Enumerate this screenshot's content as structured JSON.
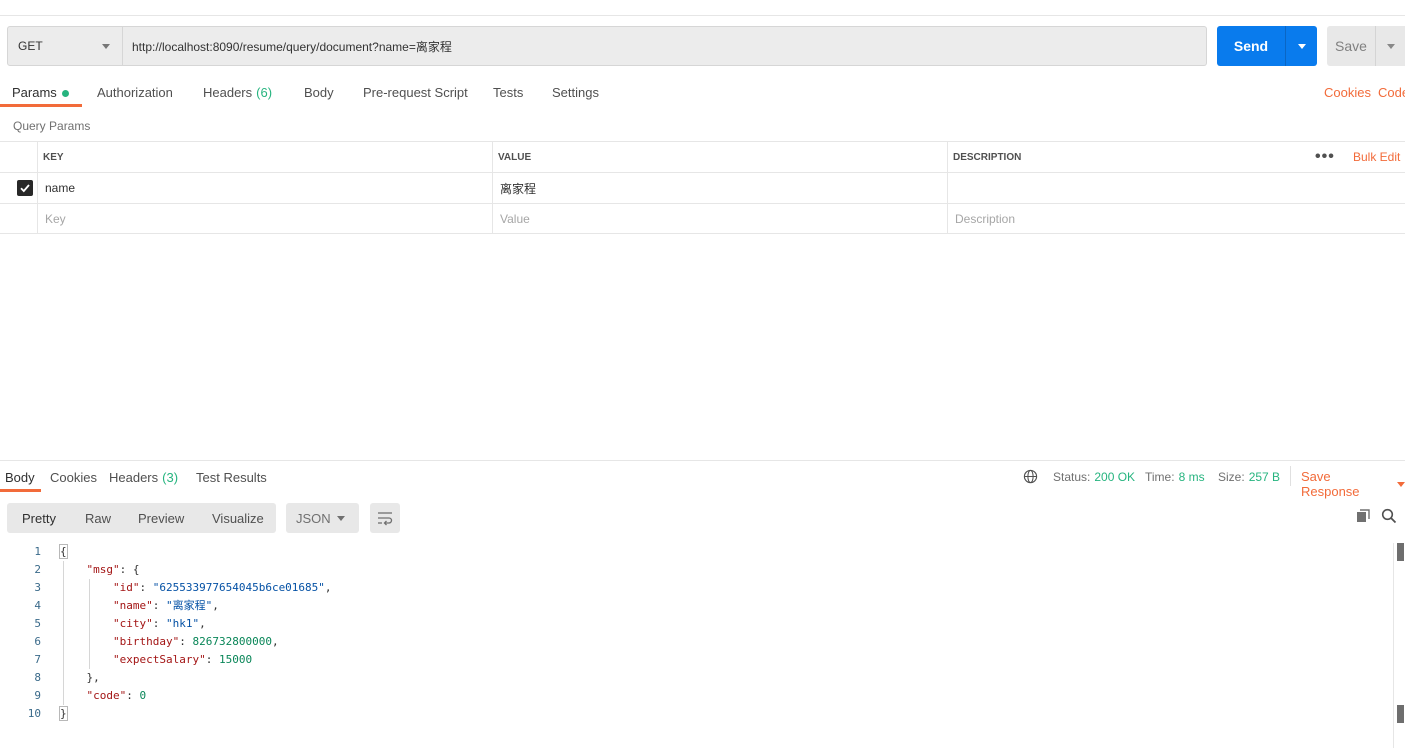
{
  "request": {
    "method": "GET",
    "url": "http://localhost:8090/resume/query/document?name=离家程",
    "send_label": "Send",
    "save_label": "Save"
  },
  "request_tabs": [
    {
      "label": "Params",
      "count": ""
    },
    {
      "label": "Authorization",
      "count": ""
    },
    {
      "label": "Headers",
      "count": "(6)"
    },
    {
      "label": "Body",
      "count": ""
    },
    {
      "label": "Pre-request Script",
      "count": ""
    },
    {
      "label": "Tests",
      "count": ""
    },
    {
      "label": "Settings",
      "count": ""
    }
  ],
  "right_links": {
    "cookies": "Cookies",
    "code": "Code"
  },
  "query_params": {
    "title": "Query Params",
    "headers": {
      "key": "KEY",
      "value": "VALUE",
      "description": "DESCRIPTION"
    },
    "bulk_edit": "Bulk Edit",
    "more": "•••",
    "rows": [
      {
        "key": "name",
        "value": "离家程",
        "description": "",
        "checked": true
      }
    ],
    "placeholders": {
      "key": "Key",
      "value": "Value",
      "description": "Description"
    }
  },
  "response_tabs": [
    {
      "label": "Body",
      "count": ""
    },
    {
      "label": "Cookies",
      "count": ""
    },
    {
      "label": "Headers",
      "count": "(3)"
    },
    {
      "label": "Test Results",
      "count": ""
    }
  ],
  "response_meta": {
    "status_label": "Status:",
    "status_value": "200 OK",
    "time_label": "Time:",
    "time_value": "8 ms",
    "size_label": "Size:",
    "size_value": "257 B",
    "save_response": "Save Response"
  },
  "view_modes": [
    "Pretty",
    "Raw",
    "Preview",
    "Visualize"
  ],
  "format": "JSON",
  "code_lines": [
    {
      "n": "1"
    },
    {
      "n": "2"
    },
    {
      "n": "3"
    },
    {
      "n": "4"
    },
    {
      "n": "5"
    },
    {
      "n": "6"
    },
    {
      "n": "7"
    },
    {
      "n": "8"
    },
    {
      "n": "9"
    },
    {
      "n": "10"
    }
  ],
  "json_body": {
    "msg_key": "\"msg\"",
    "id_key": "\"id\"",
    "id_val": "\"625533977654045b6ce01685\"",
    "name_key": "\"name\"",
    "name_val": "\"离家程\"",
    "city_key": "\"city\"",
    "city_val": "\"hk1\"",
    "birthday_key": "\"birthday\"",
    "birthday_val": "826732800000",
    "salary_key": "\"expectSalary\"",
    "salary_val": "15000",
    "code_key": "\"code\"",
    "code_val": "0"
  }
}
